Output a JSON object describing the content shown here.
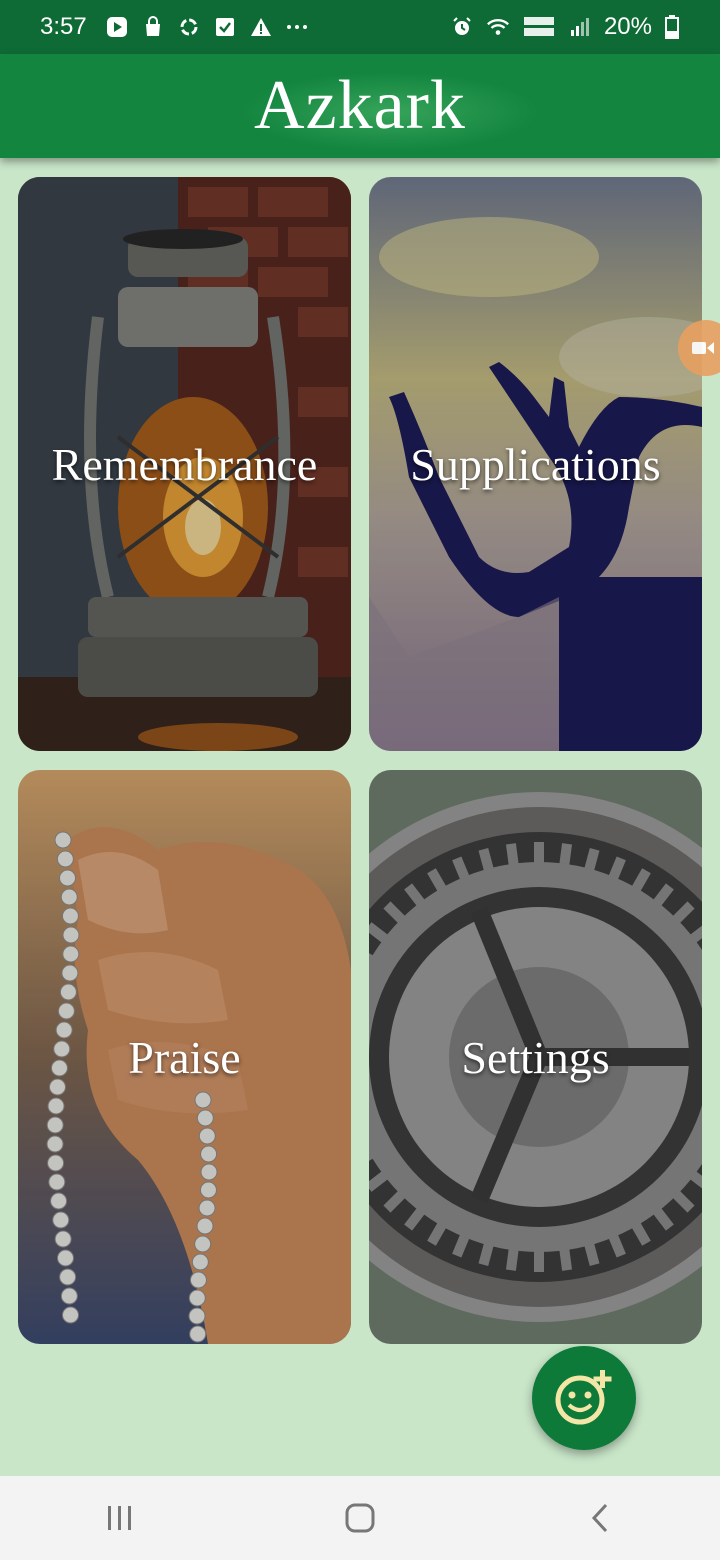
{
  "status_bar": {
    "time": "3:57",
    "battery": "20%",
    "left_icons": [
      "play-icon",
      "bag-icon",
      "recycle-icon",
      "check-icon",
      "warning-icon",
      "more-icon"
    ],
    "right_icons": [
      "alarm-icon",
      "wifi-icon",
      "volte-icon",
      "signal-icon",
      "battery-icon"
    ],
    "volte_text": "Vo)) LTE1"
  },
  "app_bar": {
    "title": "Azkark"
  },
  "cards": [
    {
      "label": "Remembrance",
      "image": "lantern"
    },
    {
      "label": "Supplications",
      "image": "praying-hands"
    },
    {
      "label": "Praise",
      "image": "prayer-beads"
    },
    {
      "label": "Settings",
      "image": "gear"
    }
  ],
  "fab": {
    "icon": "add-emoji-icon"
  },
  "nav_bar": {
    "buttons": [
      "recents-icon",
      "home-icon",
      "back-icon"
    ]
  },
  "colors": {
    "status_bar": "#0f6b35",
    "app_bar": "#13853f",
    "background": "#c9e6c9",
    "fab": "#0d7a3a"
  }
}
